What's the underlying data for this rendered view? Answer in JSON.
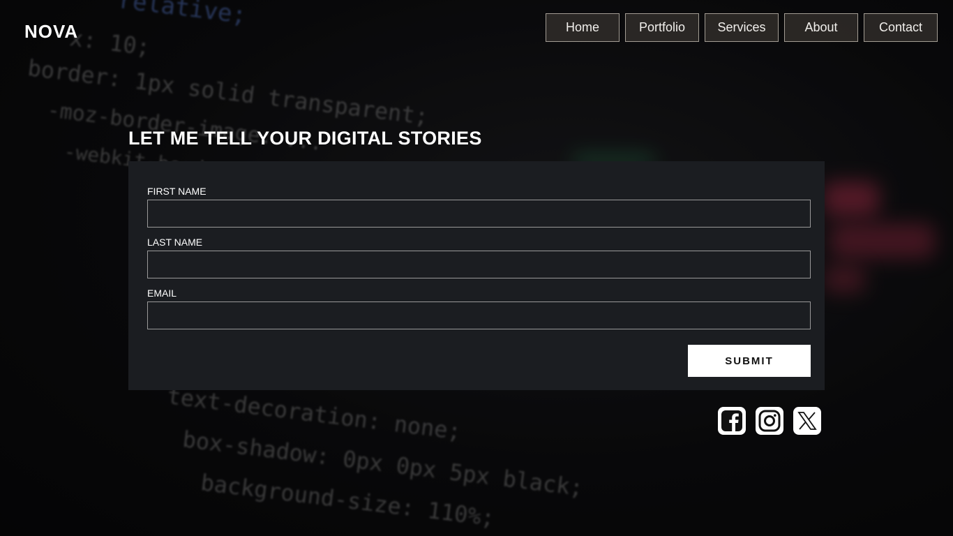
{
  "brand": {
    "logo": "NOVA"
  },
  "nav": {
    "items": [
      {
        "label": "Home"
      },
      {
        "label": "Portfolio"
      },
      {
        "label": "Services"
      },
      {
        "label": "About"
      },
      {
        "label": "Contact"
      }
    ]
  },
  "hero": {
    "title": "LET ME TELL YOUR DIGITAL STORIES"
  },
  "form": {
    "first_name_label": "FIRST NAME",
    "first_name_value": "",
    "last_name_label": "LAST NAME",
    "last_name_value": "",
    "email_label": "EMAIL",
    "email_value": "",
    "submit_label": "SUBMIT"
  },
  "social": {
    "icons": [
      "facebook-icon",
      "instagram-icon",
      "x-icon"
    ]
  },
  "background_code": [
    "relative;",
    "x: 10;",
    "border: 1px solid transparent;",
    "-moz-border-image: ...",
    "-webkit-border-...",
    "text-decoration: none;",
    "box-shadow: 0px 0px 5px black;",
    "background-size: 110%;"
  ],
  "colors": {
    "card_bg": "#1b1d21",
    "nav_bg": "#46403a",
    "nav_border": "#a39d94",
    "text": "#ffffff"
  }
}
